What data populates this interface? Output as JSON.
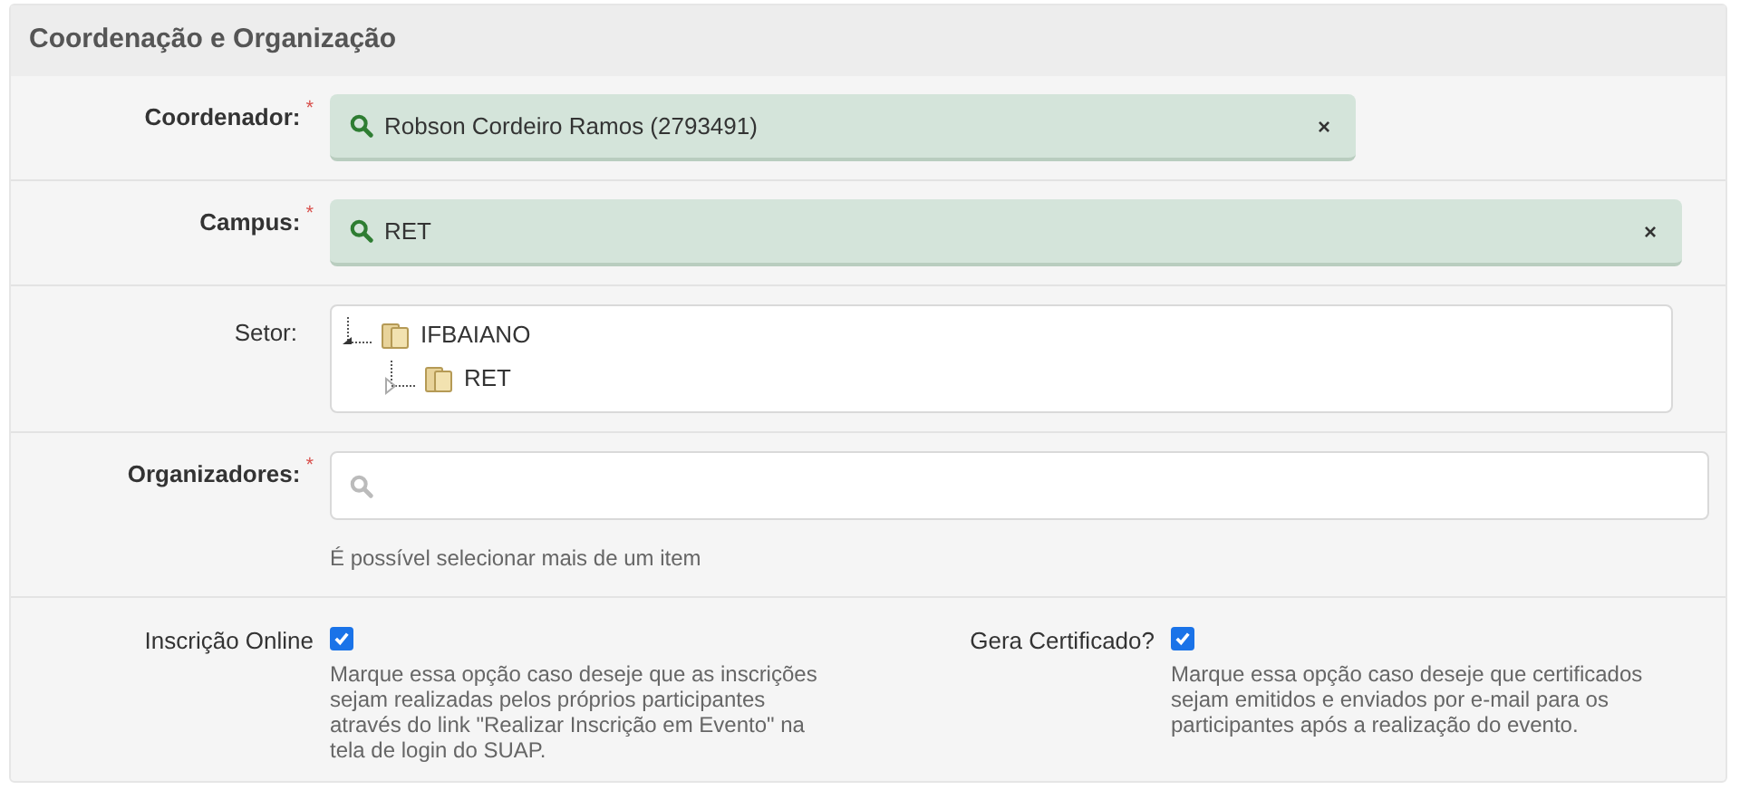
{
  "section": {
    "title": "Coordenação e Organização"
  },
  "fields": [
    {
      "kind": "autocomplete",
      "label": "Coordenador:",
      "required_mark": "*",
      "value": "Robson Cordeiro Ramos (2793491)",
      "clear": "×"
    },
    {
      "kind": "autocomplete",
      "label": "Campus:",
      "required_mark": "*",
      "value": "RET",
      "clear": "×"
    },
    {
      "kind": "tree",
      "label": "Setor:",
      "nodes": [
        {
          "label": "IFBAIANO",
          "expanded": true,
          "children": [
            {
              "label": "RET",
              "expanded": false
            }
          ]
        }
      ]
    },
    {
      "kind": "multiselect",
      "label": "Organizadores:",
      "required_mark": "*",
      "help": "É possível selecionar mais de um item"
    }
  ],
  "checkboxes": [
    {
      "label": "Inscrição Online",
      "checked": true,
      "help": "Marque essa opção caso deseje que as inscrições sejam realizadas pelos próprios participantes através do link \"Realizar Inscrição em Evento\" na tela de login do SUAP."
    },
    {
      "label": "Gera Certificado?",
      "checked": true,
      "help": "Marque essa opção caso deseje que certificados sejam emitidos e enviados por e-mail para os participantes após a realização do evento."
    }
  ]
}
